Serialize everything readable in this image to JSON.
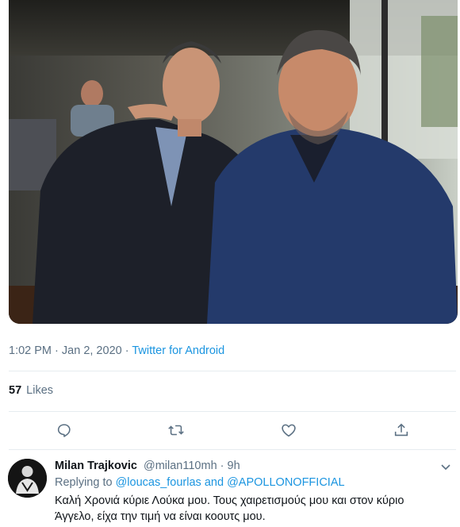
{
  "tweet": {
    "time": "1:02 PM",
    "separator": "·",
    "date": "Jan 2, 2020",
    "source": "Twitter for Android",
    "likes_count": "57",
    "likes_label": "Likes"
  },
  "actions": {
    "reply_icon": "reply-icon",
    "retweet_icon": "retweet-icon",
    "like_icon": "heart-icon",
    "share_icon": "share-icon"
  },
  "reply": {
    "name": "Milan Trajkovic",
    "handle": "@milan110mh",
    "separator": "·",
    "time_ago": "9h",
    "replying_prefix": "Replying to",
    "mention_1": "@loucas_fourlas",
    "and_word": "and",
    "mention_2": "@APOLLONOFFICIAL",
    "text": "Καλή Χρονιά κύριε Λούκα μου. Τους χαιρετισμούς μου και στον κύριο Άγγελο, είχα την τιμή να είναι κοουτς μου."
  },
  "colors": {
    "link": "#1b95e0",
    "muted": "#5b7083",
    "divider": "#e6ecf0"
  }
}
